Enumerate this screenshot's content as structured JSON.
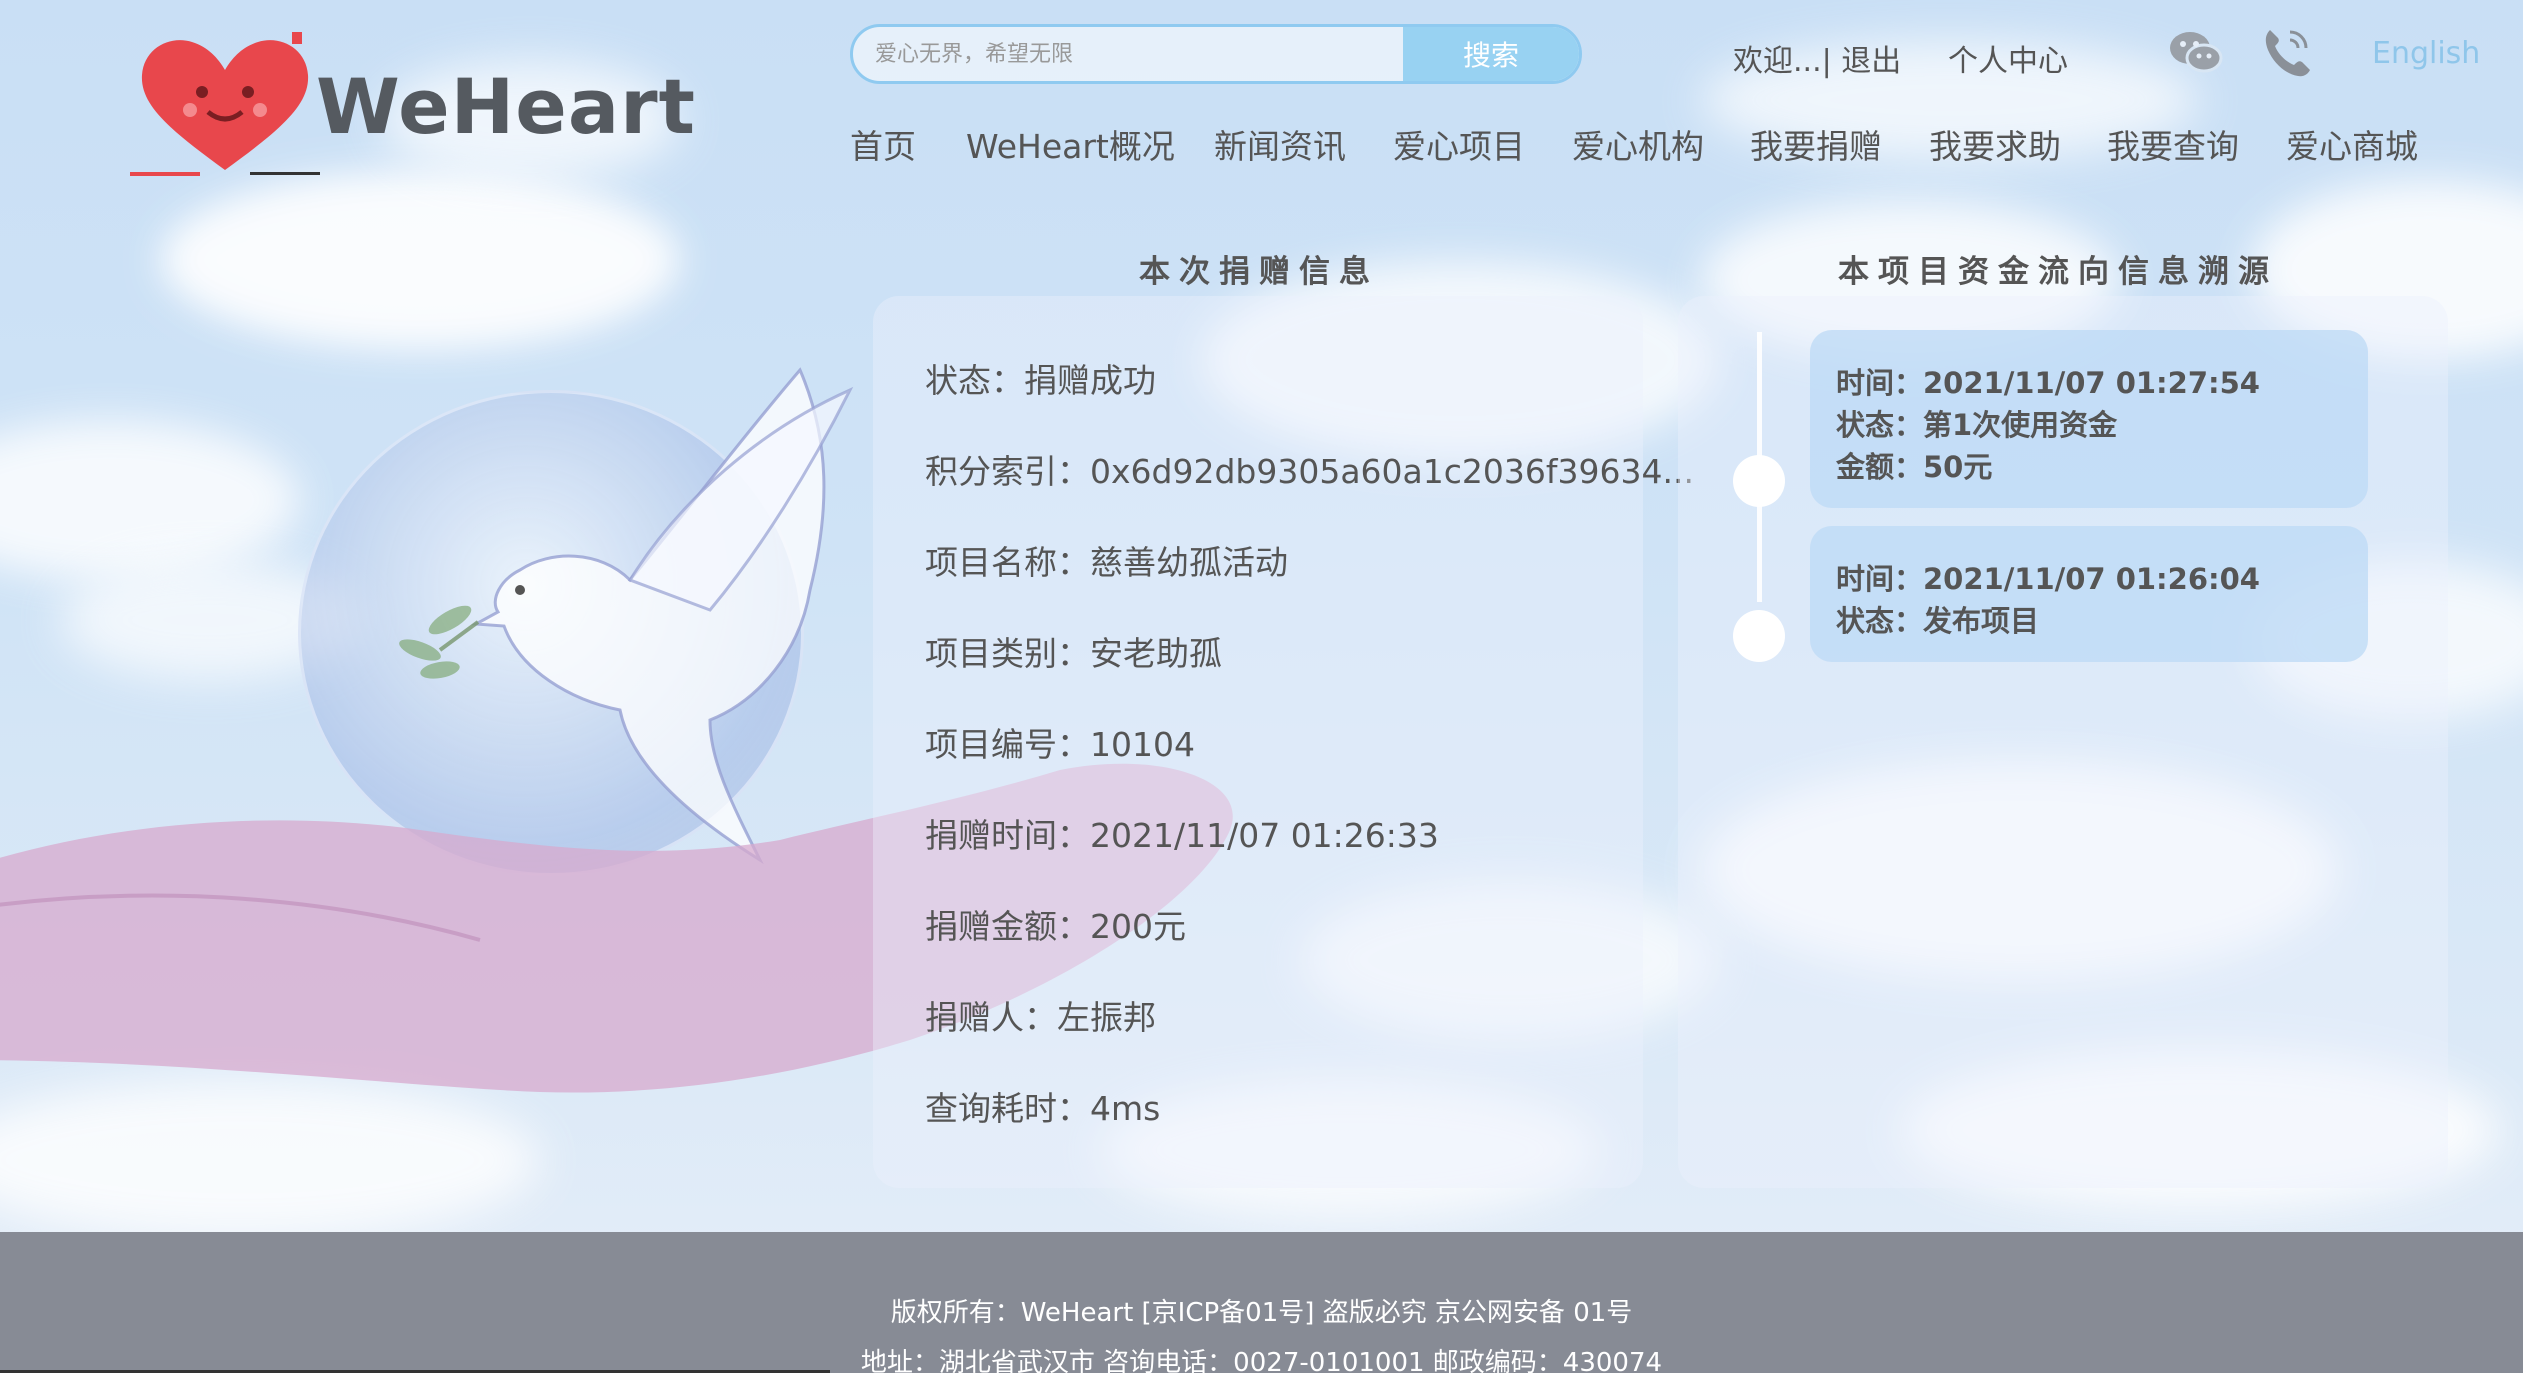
{
  "brand": {
    "name": "WeHeart"
  },
  "search": {
    "placeholder": "爱心无界，希望无限",
    "button_label": "搜索"
  },
  "top_links": {
    "welcome": "欢迎...| 退出",
    "personal_center": "个人中心",
    "language": "English"
  },
  "icons": {
    "wechat": "wechat-icon",
    "phone": "phone-icon"
  },
  "nav": {
    "items": [
      "首页",
      "WeHeart概况",
      "新闻资讯",
      "爱心项目",
      "爱心机构",
      "我要捐赠",
      "我要求助",
      "我要查询",
      "爱心商城"
    ]
  },
  "donation": {
    "title": "本次捐赠信息",
    "rows": [
      "状态：捐赠成功",
      "积分索引：0x6d92db9305a60a1c2036f39634...",
      "项目名称：慈善幼孤活动",
      "项目类别：安老助孤",
      "项目编号：10104",
      "捐赠时间：2021/11/07 01:26:33",
      "捐赠金额：200元",
      "捐赠人：左振邦",
      "查询耗时：4ms"
    ]
  },
  "trace": {
    "title": "本项目资金流向信息溯源",
    "entries": [
      {
        "time": "时间：2021/11/07 01:27:54",
        "status": "状态：第1次使用资金",
        "amount": "金额：50元"
      },
      {
        "time": "时间：2021/11/07 01:26:04",
        "status": "状态：发布项目"
      }
    ]
  },
  "footer": {
    "line1": "版权所有：WeHeart   [京ICP备01号] 盗版必究  京公网安备 01号",
    "line2": "地址：湖北省武汉市  咨询电话：0027-0101001  邮政编码：430074"
  },
  "colors": {
    "search_border": "#8fcaf0",
    "search_button": "#98d2f2",
    "english_link": "#8fc6ea",
    "footer_bg": "#878b95",
    "logo_heart": "#e8474c"
  }
}
